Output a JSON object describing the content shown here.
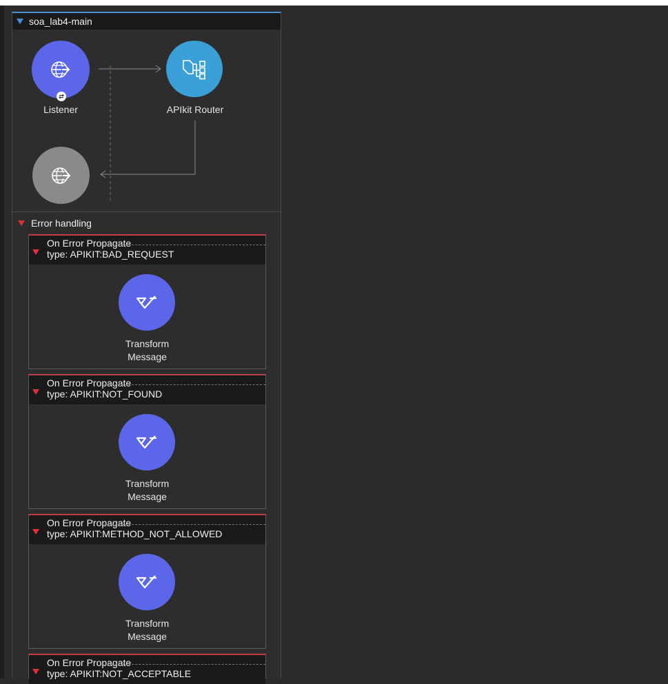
{
  "flow": {
    "name": "soa_lab4-main",
    "listener_label": "Listener",
    "router_label": "APIkit Router"
  },
  "error_handling": {
    "label": "Error handling",
    "scopes": [
      {
        "title": "On Error Propagate",
        "type": "type: APIKIT:BAD_REQUEST",
        "component": [
          "Transform",
          "Message"
        ]
      },
      {
        "title": "On Error Propagate",
        "type": "type: APIKIT:NOT_FOUND",
        "component": [
          "Transform",
          "Message"
        ]
      },
      {
        "title": "On Error Propagate",
        "type": "type: APIKIT:METHOD_NOT_ALLOWED",
        "component": [
          "Transform",
          "Message"
        ]
      },
      {
        "title": "On Error Propagate",
        "type": "type: APIKIT:NOT_ACCEPTABLE"
      }
    ]
  },
  "icons": {
    "listener": "globe-arrow-icon",
    "router": "router-tree-icon",
    "response": "globe-arrow-icon",
    "transform": "transform-message-icon"
  },
  "colors": {
    "flow_accent": "#4a90d9",
    "error_accent": "#c23b45",
    "listener": "#5b67e8",
    "router": "#3b9fd8",
    "transform": "#5b67e8",
    "response": "#8a8a8a"
  }
}
